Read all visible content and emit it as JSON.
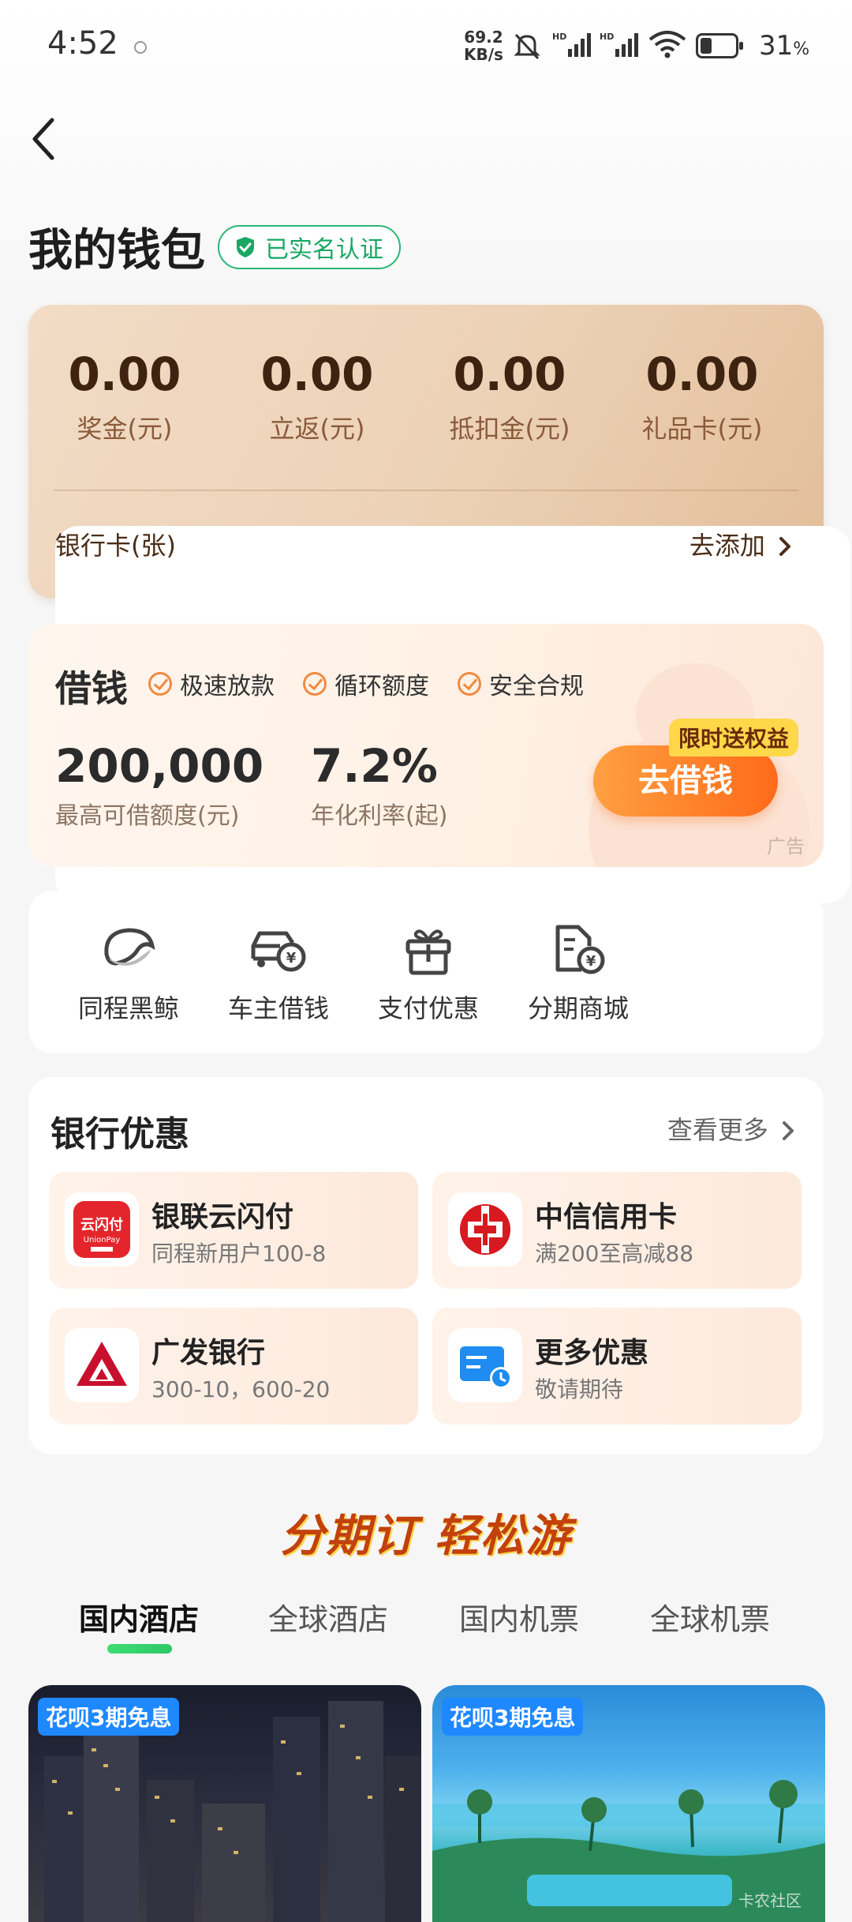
{
  "status": {
    "time": "4:52",
    "net_speed_value": "69.2",
    "net_speed_unit": "KB/s",
    "battery": "31",
    "battery_pct_sign": "%"
  },
  "header": {
    "title": "我的钱包",
    "verified": "已实名认证"
  },
  "wallet": {
    "items": [
      {
        "value": "0.00",
        "label": "奖金(元)"
      },
      {
        "value": "0.00",
        "label": "立返(元)"
      },
      {
        "value": "0.00",
        "label": "抵扣金(元)"
      },
      {
        "value": "0.00",
        "label": "礼品卡(元)"
      }
    ],
    "bank_label": "银行卡(张)",
    "add_label": "去添加"
  },
  "loan": {
    "title": "借钱",
    "tags": [
      "极速放款",
      "循环额度",
      "安全合规"
    ],
    "amount": "200,000",
    "amount_label": "最高可借额度(元)",
    "rate": "7.2%",
    "rate_label": "年化利率(起)",
    "button": "去借钱",
    "badge": "限时送权益",
    "ad": "广告"
  },
  "quick": [
    {
      "label": "同程黑鲸",
      "icon": "whale-icon"
    },
    {
      "label": "车主借钱",
      "icon": "car-loan-icon"
    },
    {
      "label": "支付优惠",
      "icon": "gift-icon"
    },
    {
      "label": "分期商城",
      "icon": "installment-mall-icon"
    }
  ],
  "bank_offers": {
    "title": "银行优惠",
    "more": "查看更多",
    "items": [
      {
        "name": "银联云闪付",
        "desc": "同程新用户100-8",
        "icon": "unionpay-logo",
        "logo_text": "云闪付",
        "logo_sub": "UnionPay"
      },
      {
        "name": "中信信用卡",
        "desc": "满200至高减88",
        "icon": "citic-logo"
      },
      {
        "name": "广发银行",
        "desc": "300-10，600-20",
        "icon": "cgb-logo"
      },
      {
        "name": "更多优惠",
        "desc": "敬请期待",
        "icon": "more-offers-icon"
      }
    ]
  },
  "promo": {
    "slogan": "分期订 轻松游",
    "tabs": [
      "国内酒店",
      "全球酒店",
      "国内机票",
      "全球机票"
    ],
    "active_tab": 0,
    "cards": [
      {
        "badge": "花呗3期免息"
      },
      {
        "badge": "花呗3期免息"
      }
    ],
    "watermark": "卡农社区"
  },
  "colors": {
    "accent_green": "#2bb673",
    "loan_orange": "#ff6a1a",
    "wallet_brown": "#3d2310",
    "badge_blue": "#1e88ff"
  }
}
